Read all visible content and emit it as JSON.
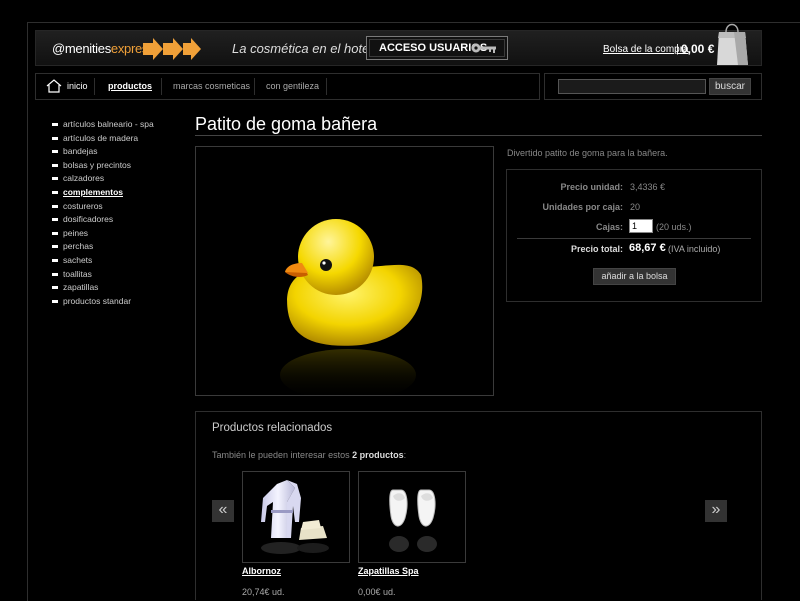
{
  "header": {
    "logo_prefix": "@menities",
    "logo_accent": "express",
    "tagline": "La cosmética en el hotel",
    "access_label": "ACCESO USUARIOS",
    "cart_link": "Bolsa de la compra",
    "cart_separator": "|",
    "cart_total": "0,00 €"
  },
  "nav": {
    "items": [
      {
        "label": "inicio"
      },
      {
        "label": "productos"
      },
      {
        "label": "marcas cosmeticas"
      },
      {
        "label": "con gentileza"
      }
    ],
    "active": "productos"
  },
  "search": {
    "value": "",
    "button_label": "buscar"
  },
  "sidebar": {
    "categories": [
      {
        "label": "artículos balneario - spa"
      },
      {
        "label": "artículos de madera"
      },
      {
        "label": "bandejas"
      },
      {
        "label": "bolsas y precintos"
      },
      {
        "label": "calzadores"
      },
      {
        "label": "complementos"
      },
      {
        "label": "costureros"
      },
      {
        "label": "dosificadores"
      },
      {
        "label": "peines"
      },
      {
        "label": "perchas"
      },
      {
        "label": "sachets"
      },
      {
        "label": "toallitas"
      },
      {
        "label": "zapatillas"
      },
      {
        "label": "productos standar"
      }
    ],
    "active": "complementos"
  },
  "product": {
    "title": "Patito de goma bañera",
    "description": "Divertido patito de goma para la bañera.",
    "unit_price_label": "Precio unidad:",
    "unit_price": "3,4336 €",
    "units_per_box_label": "Unidades por caja:",
    "units_per_box": "20",
    "boxes_label": "Cajas:",
    "boxes_value": "1",
    "boxes_units": "(20 uds.)",
    "total_label": "Precio total:",
    "total": "68,67 €",
    "vat_note": "(IVA incluido)",
    "add_button": "añadir a la bolsa"
  },
  "related": {
    "title": "Productos relacionados",
    "intro_prefix": "También le pueden interesar estos",
    "intro_count": "2 productos",
    "intro_suffix": ":",
    "prev": "«",
    "next": "»",
    "items": [
      {
        "name": "Albornoz",
        "price": "20,74€ ud."
      },
      {
        "name": "Zapatillas Spa",
        "price": "0,00€ ud."
      }
    ]
  },
  "colors": {
    "background": "#000000",
    "accent": "#f0a038"
  },
  "icons": [
    "arrow-icon",
    "key-icon",
    "shopping-bag-icon",
    "home-icon",
    "bullet-icon"
  ]
}
